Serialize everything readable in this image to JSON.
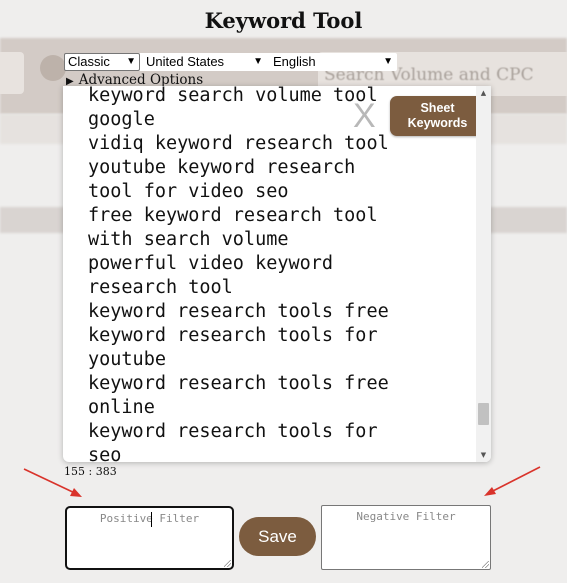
{
  "app": {
    "title": "Keyword Tool"
  },
  "controls": {
    "mode": "Classic",
    "country": "United States",
    "language": "English",
    "advanced_options": "Advanced Options"
  },
  "background": {
    "search_placeholder": "Search Volume and CPC"
  },
  "modal": {
    "keywords": [
      "keyword search volume tool",
      "google",
      "vidiq keyword research tool",
      "youtube keyword research",
      "tool for video seo",
      "free keyword research tool",
      "with search volume",
      "powerful video keyword",
      "research tool",
      "keyword research tools free",
      "keyword research tools for",
      "youtube",
      "keyword research tools free",
      "online",
      "keyword research tools for",
      "seo"
    ],
    "close_label": "X",
    "sheet_button_line1": "Sheet",
    "sheet_button_line2": "Keywords",
    "scroll_position": 0.93
  },
  "counter": "155 : 383",
  "filters": {
    "positive_placeholder": "Positive Filter",
    "negative_placeholder": "Negative Filter",
    "save_label": "Save"
  },
  "colors": {
    "accent": "#7c5c3f",
    "annotation_arrow": "#d9332b"
  }
}
